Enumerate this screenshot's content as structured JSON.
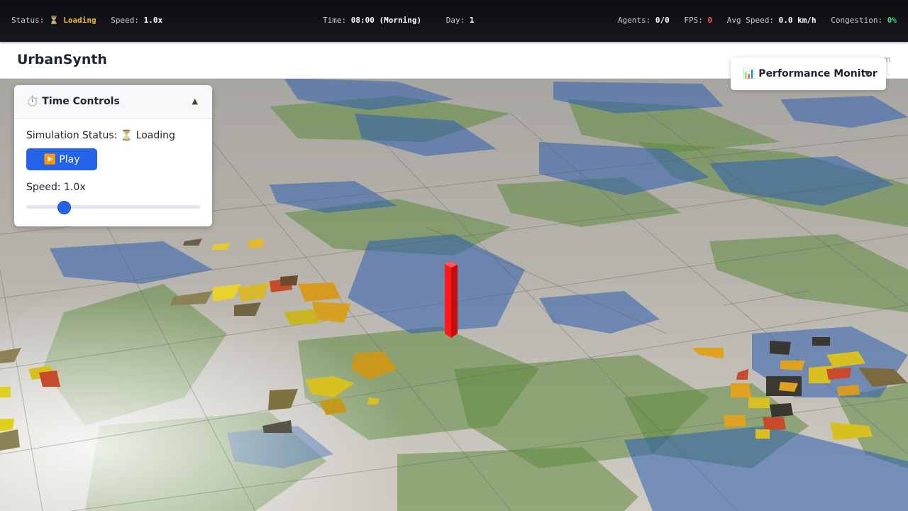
{
  "status_bar": {
    "status_label": "Status:",
    "status_value": "⏳ Loading",
    "speed_label": "Speed:",
    "speed_value": "1.0x",
    "time_label": "Time:",
    "time_value": "08:00 (Morning)",
    "day_label": "Day:",
    "day_value": "1",
    "agents_label": "Agents:",
    "agents_value": "0/0",
    "fps_label": "FPS:",
    "fps_value": "0",
    "avg_speed_label": "Avg Speed:",
    "avg_speed_value": "0.0 km/h",
    "congestion_label": "Congestion:",
    "congestion_value": "0%"
  },
  "header": {
    "title": "UrbanSynth",
    "tail_text": "m"
  },
  "time_controls": {
    "title": "⏱️ Time Controls",
    "toggle": "▲",
    "status_text": "Simulation Status: ⏳ Loading",
    "play_label": "▶️ Play",
    "speed_text": "Speed: 1.0x",
    "slider_fraction": 0.18
  },
  "performance_monitor": {
    "title": "📊 Performance Monitor",
    "toggle": "▼"
  },
  "colors": {
    "accent": "#2563eb",
    "loading": "#f5b52a",
    "alert": "#ff5b5b",
    "ok": "#49d27a",
    "marker": "#ff1a1a"
  }
}
